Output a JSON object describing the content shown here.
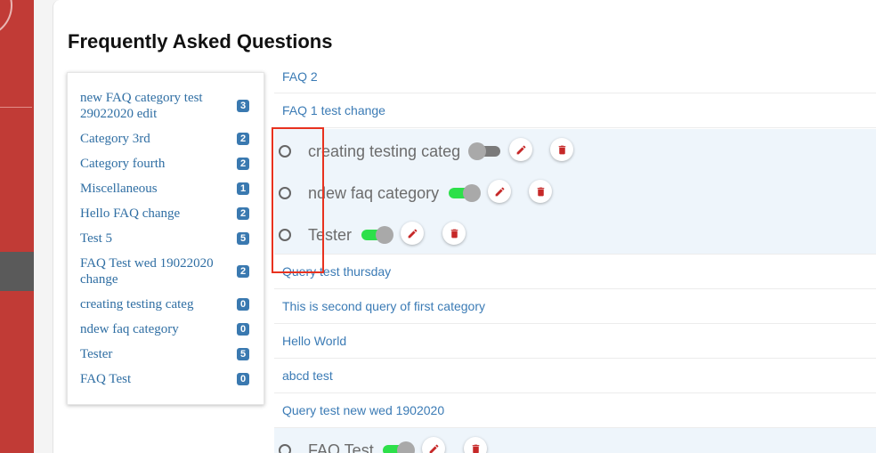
{
  "colors": {
    "sidebar": "#c13b36",
    "link": "#3b7bb5",
    "badge": "#3a79b0",
    "toggle_on": "#2de04a",
    "toggle_off": "#7a7a7a",
    "delete": "#c62828",
    "highlight": "#e8321f"
  },
  "page": {
    "title": "Frequently Asked Questions"
  },
  "categories": [
    {
      "label": "new FAQ category test 29022020 edit",
      "count": "3"
    },
    {
      "label": "Category 3rd",
      "count": "2"
    },
    {
      "label": "Category fourth",
      "count": "2"
    },
    {
      "label": "Miscellaneous",
      "count": "1"
    },
    {
      "label": "Hello FAQ change",
      "count": "2"
    },
    {
      "label": "Test 5",
      "count": "5"
    },
    {
      "label": "FAQ Test wed 19022020 change",
      "count": "2"
    },
    {
      "label": "creating testing categ",
      "count": "0"
    },
    {
      "label": "ndew faq category",
      "count": "0"
    },
    {
      "label": "Tester",
      "count": "5"
    },
    {
      "label": "FAQ Test",
      "count": "0"
    }
  ],
  "faq": {
    "top_questions": [
      "FAQ 2",
      "FAQ 1 test change"
    ],
    "category_rows": [
      {
        "name": "creating testing categ",
        "enabled": false,
        "edit_icon": "pencil-icon",
        "delete_icon": "trash-icon"
      },
      {
        "name": "ndew faq category",
        "enabled": true,
        "edit_icon": "pencil-icon",
        "delete_icon": "trash-icon"
      },
      {
        "name": "Tester",
        "enabled": true,
        "edit_icon": "pencil-icon",
        "delete_icon": "trash-icon"
      }
    ],
    "middle_questions": [
      "Query test thursday",
      "This is second query of first category",
      "Hello World",
      "abcd test",
      "Query test new wed 1902020"
    ],
    "bottom_category": {
      "name": "FAQ Test",
      "enabled": true
    }
  }
}
